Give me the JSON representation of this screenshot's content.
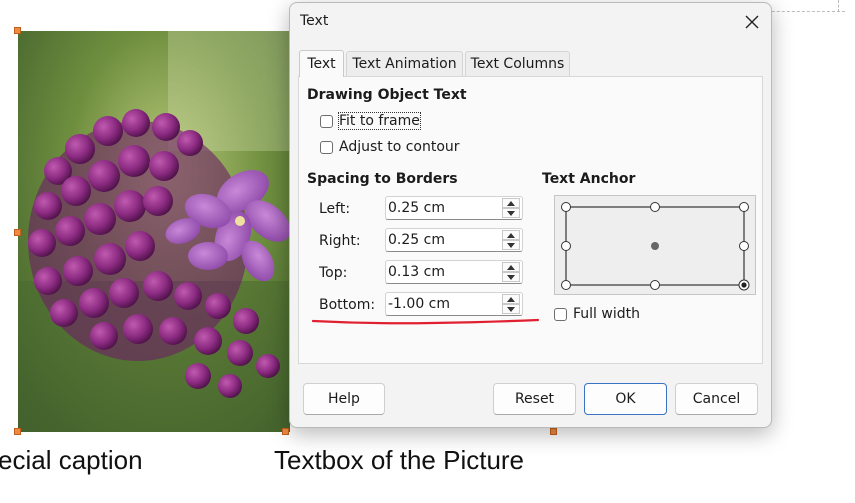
{
  "document": {
    "caption_left": "ecial caption",
    "caption_right": "Textbox of the Picture"
  },
  "dialog": {
    "title": "Text",
    "tabs": [
      {
        "label": "Text",
        "active": true
      },
      {
        "label": "Text Animation",
        "active": false
      },
      {
        "label": "Text Columns",
        "active": false
      }
    ],
    "drawing_object_text": {
      "heading": "Drawing Object Text",
      "fit_to_frame": {
        "label": "Fit to frame",
        "checked": false
      },
      "adjust_to_contour": {
        "label": "Adjust to contour",
        "checked": false
      }
    },
    "spacing": {
      "heading": "Spacing to Borders",
      "fields": [
        {
          "label": "Left:",
          "value": "0.25 cm"
        },
        {
          "label": "Right:",
          "value": "0.25 cm"
        },
        {
          "label": "Top:",
          "value": "0.13 cm"
        },
        {
          "label": "Bottom:",
          "value": "-1.00 cm"
        }
      ]
    },
    "text_anchor": {
      "heading": "Text Anchor",
      "selected": "bottom-right",
      "full_width": {
        "label": "Full width",
        "checked": false
      }
    },
    "buttons": {
      "help": "Help",
      "reset": "Reset",
      "ok": "OK",
      "cancel": "Cancel"
    }
  },
  "colors": {
    "accent": "#3b73c4",
    "handle": "#f08a40",
    "annotation_red": "#e02030"
  }
}
